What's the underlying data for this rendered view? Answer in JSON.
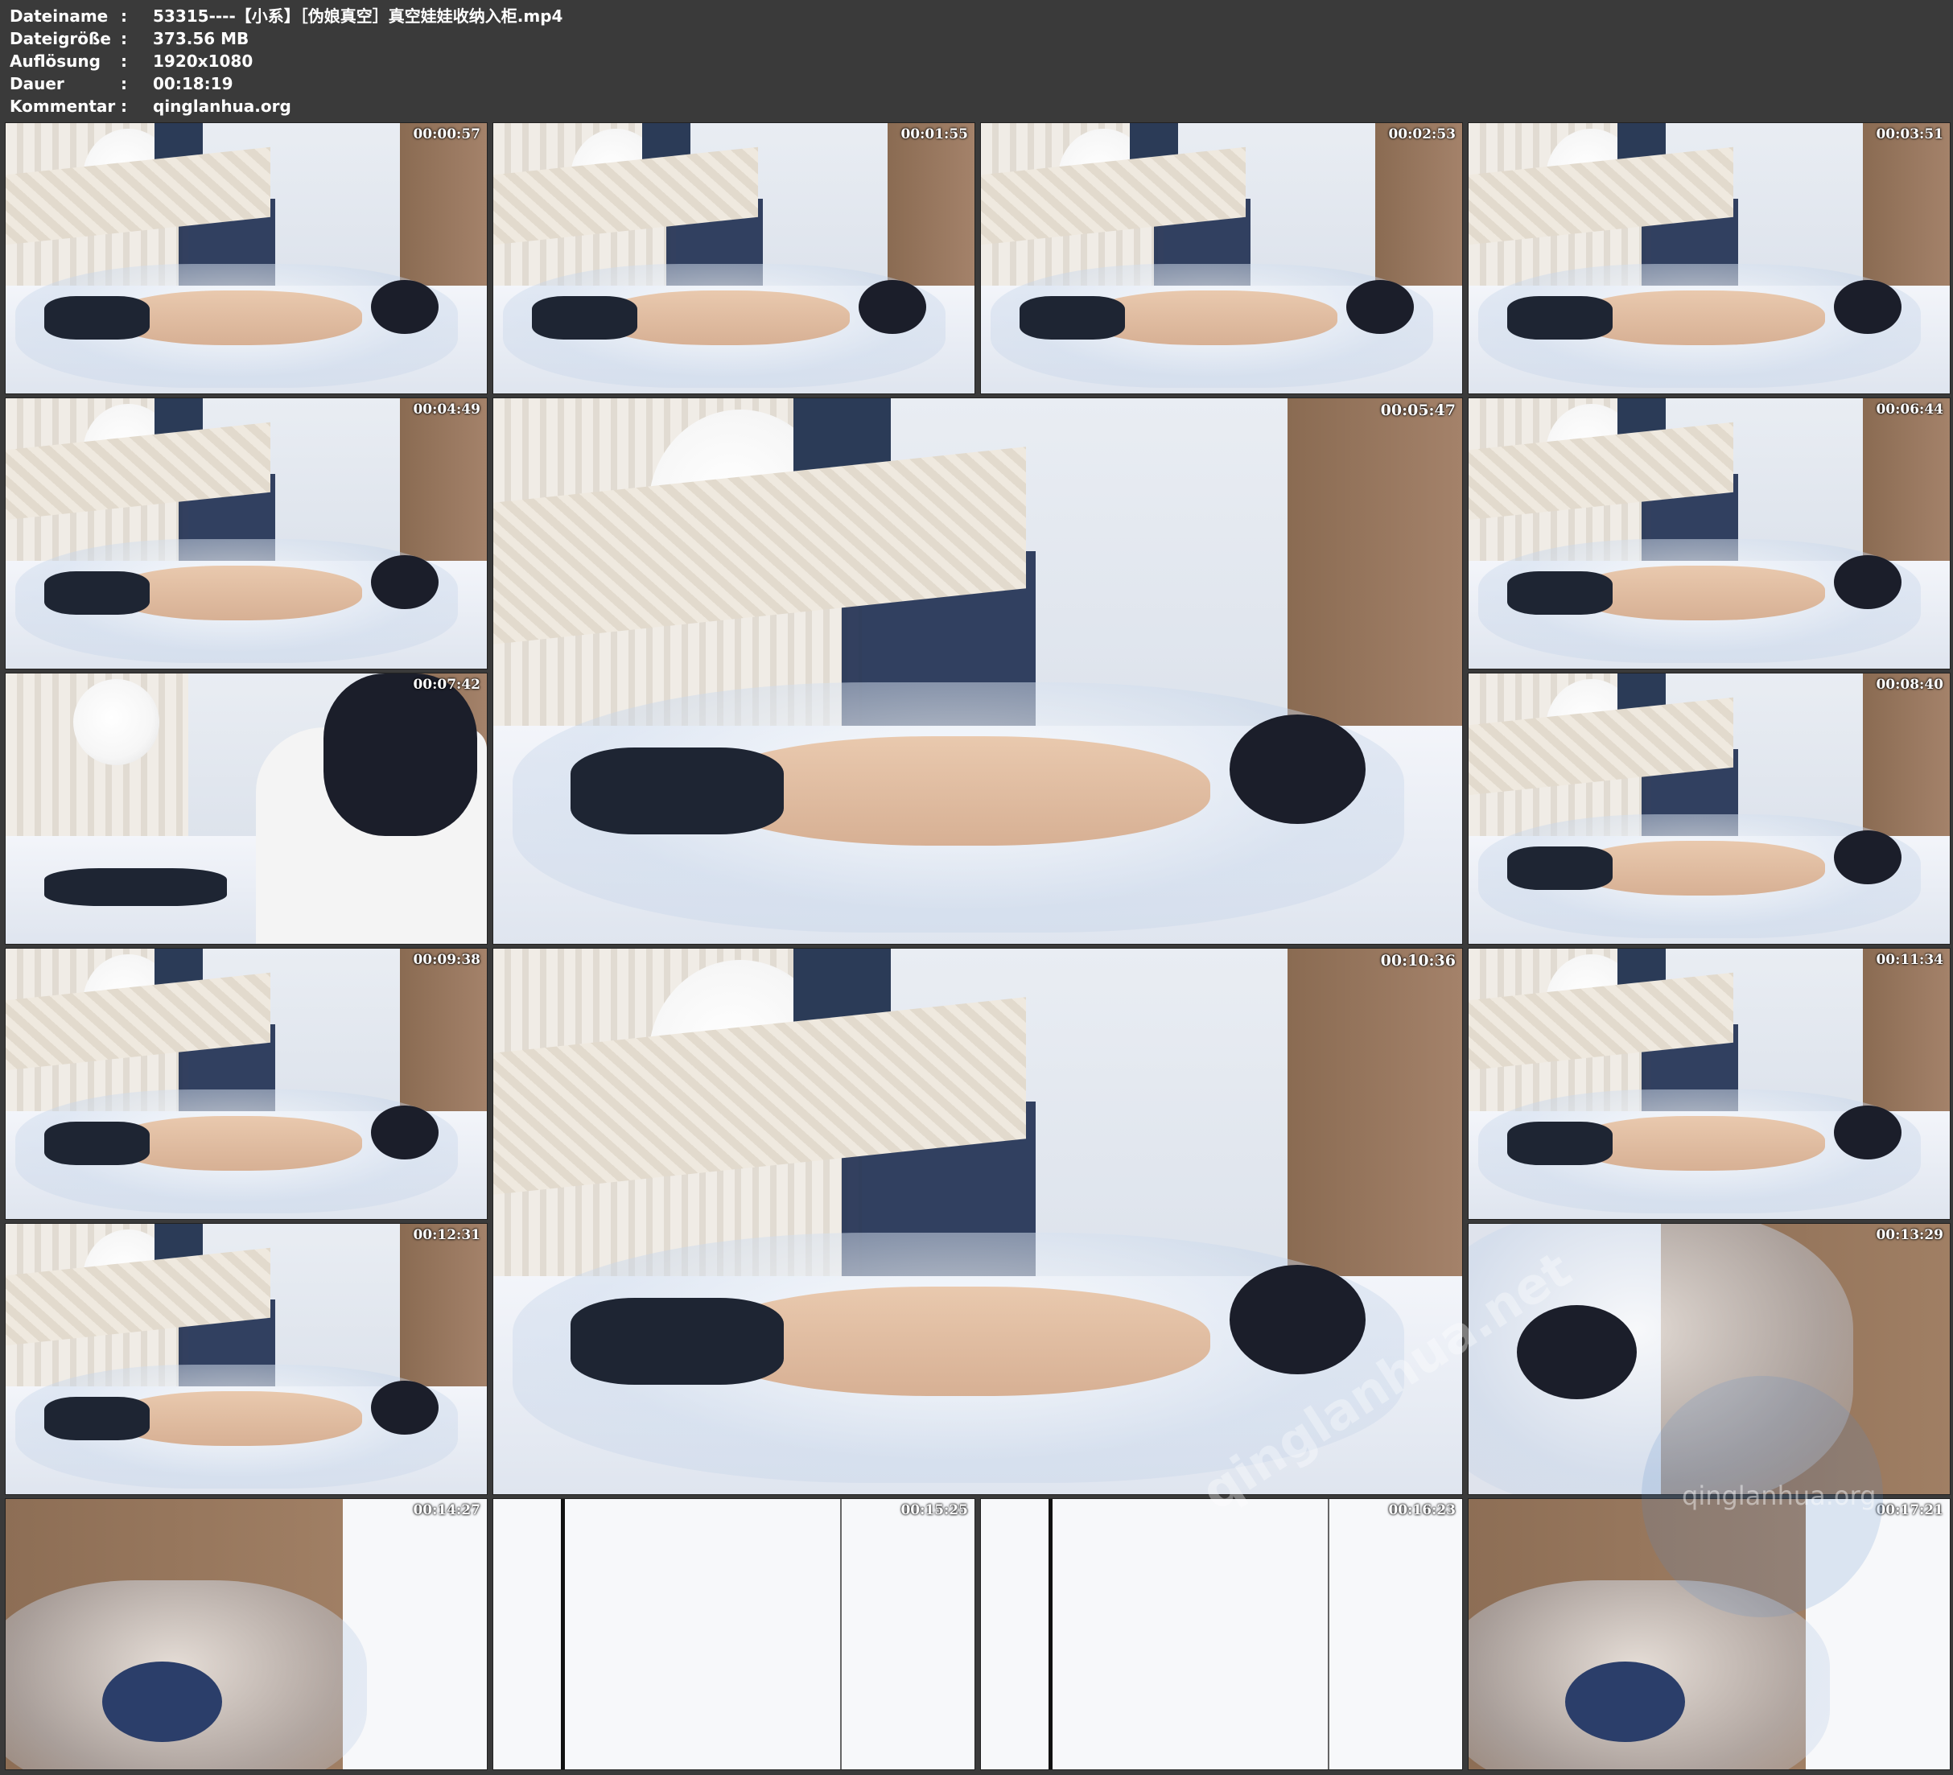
{
  "meta": {
    "rows": [
      {
        "key": "Dateiname",
        "sep": ":",
        "value": "53315----【小系】［伪娘真空］真空娃娃收纳入柜.mp4"
      },
      {
        "key": "Dateigröße",
        "sep": ":",
        "value": "373.56 MB"
      },
      {
        "key": "Auflösung",
        "sep": ":",
        "value": "1920x1080"
      },
      {
        "key": "Dauer",
        "sep": ":",
        "value": "00:18:19"
      },
      {
        "key": "Kommentar",
        "sep": ":",
        "value": "qinglanhua.org"
      }
    ]
  },
  "thumbnails": [
    {
      "time": "00:00:57",
      "scene": "bed-wide"
    },
    {
      "time": "00:01:55",
      "scene": "bed-wide"
    },
    {
      "time": "00:02:53",
      "scene": "bed-wide"
    },
    {
      "time": "00:03:51",
      "scene": "bed-wide"
    },
    {
      "time": "00:04:49",
      "scene": "bed-wide"
    },
    {
      "time": "00:05:47",
      "scene": "bed-large"
    },
    {
      "time": "00:06:44",
      "scene": "bed-wide"
    },
    {
      "time": "00:07:42",
      "scene": "bed-close"
    },
    {
      "time": "00:08:40",
      "scene": "bed-wide"
    },
    {
      "time": "00:09:38",
      "scene": "bed-wide"
    },
    {
      "time": "00:10:36",
      "scene": "bed-large"
    },
    {
      "time": "00:11:34",
      "scene": "bed-wide"
    },
    {
      "time": "00:12:31",
      "scene": "bed-wide"
    },
    {
      "time": "00:13:29",
      "scene": "plastic-close"
    },
    {
      "time": "00:14:27",
      "scene": "closet"
    },
    {
      "time": "00:15:25",
      "scene": "door"
    },
    {
      "time": "00:16:23",
      "scene": "door"
    },
    {
      "time": "00:17:21",
      "scene": "closet"
    }
  ],
  "watermark": {
    "main": "qinglanhua.net",
    "small": "qinglanhua.org"
  }
}
